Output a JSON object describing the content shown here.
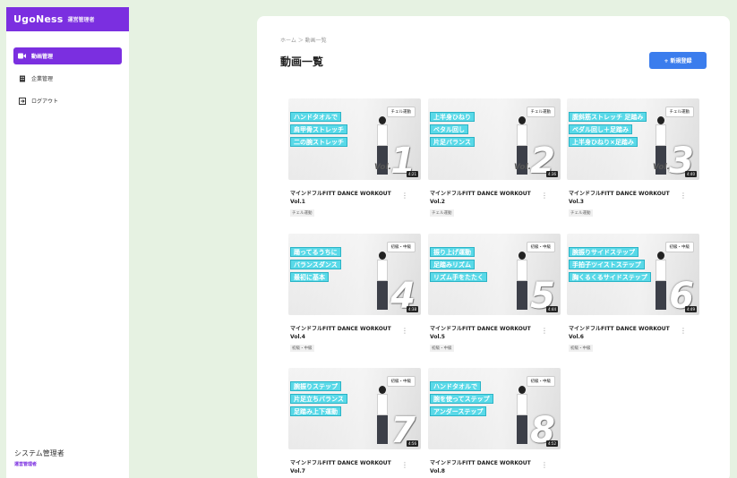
{
  "sidebar": {
    "brand_name": "UgoNess",
    "brand_role": "運営管理者",
    "items": [
      {
        "label": "動画管理",
        "icon": "video-icon",
        "active": true
      },
      {
        "label": "企業管理",
        "icon": "building-icon",
        "active": false
      },
      {
        "label": "ログアウト",
        "icon": "logout-icon",
        "active": false
      }
    ],
    "user_name": "システム管理者",
    "user_role": "運営管理者"
  },
  "header": {
    "breadcrumb": "ホーム ＞ 動画一覧",
    "title": "動画一覧",
    "new_button": "+ 新規登録"
  },
  "colors": {
    "brand": "#7b2fe0",
    "primary_button": "#3b7ded",
    "caption_bg": "#59d9e8",
    "background": "#e6f2e2"
  },
  "videos": [
    {
      "tag": "チェル運動",
      "captions": [
        "ハンドタオルで",
        "肩甲骨ストレッチ",
        "二の腕ストレッチ"
      ],
      "vol": "Vol.",
      "number": "1",
      "duration": "4:21",
      "title": "マインドフルFITT DANCE WORKOUT Vol.1",
      "label": "チェル運動"
    },
    {
      "tag": "チェル運動",
      "captions": [
        "上半身ひねり",
        "ベタル回し",
        "片足バランス"
      ],
      "vol": "Vol.",
      "number": "2",
      "duration": "4:36",
      "title": "マインドフルFITT DANCE WORKOUT Vol.2",
      "label": "チェル運動"
    },
    {
      "tag": "チェル運動",
      "captions": [
        "腹斜筋ストレッチ 足踏み",
        "ペダル回し＋足踏み",
        "上半身ひねり×足踏み"
      ],
      "vol": "Vol.",
      "number": "3",
      "duration": "4:40",
      "title": "マインドフルFITT DANCE WORKOUT Vol.3",
      "label": "チェル運動"
    },
    {
      "tag": "初級・中級",
      "captions": [
        "踊ってるうちに",
        "バランスダンス",
        "最初に基本"
      ],
      "vol": "",
      "number": "4",
      "duration": "4:38",
      "title": "マインドフルFITT DANCE WORKOUT Vol.4",
      "label": "初級・中級"
    },
    {
      "tag": "初級・中級",
      "captions": [
        "振り上げ運動",
        "足踏みリズム",
        "リズム手をたたく"
      ],
      "vol": "",
      "number": "5",
      "duration": "4:44",
      "title": "マインドフルFITT DANCE WORKOUT Vol.5",
      "label": "初級・中級"
    },
    {
      "tag": "初級・中級",
      "captions": [
        "腕振りサイドステップ",
        "手拍子ツイストステップ",
        "胸くるくるサイドステップ"
      ],
      "vol": "",
      "number": "6",
      "duration": "4:49",
      "title": "マインドフルFITT DANCE WORKOUT Vol.6",
      "label": "初級・中級"
    },
    {
      "tag": "初級・中級",
      "captions": [
        "腕振りステップ",
        "片足立ちバランス",
        "足踏み上下運動"
      ],
      "vol": "",
      "number": "7",
      "duration": "4:56",
      "title": "マインドフルFITT DANCE WORKOUT Vol.7",
      "label": "初級・中級"
    },
    {
      "tag": "初級・中級",
      "captions": [
        "ハンドタオルで",
        "腕を使ってステップ",
        "アンダーステップ"
      ],
      "vol": "",
      "number": "8",
      "duration": "4:52",
      "title": "マインドフルFITT DANCE WORKOUT Vol.8",
      "label": "初級・中級"
    }
  ]
}
